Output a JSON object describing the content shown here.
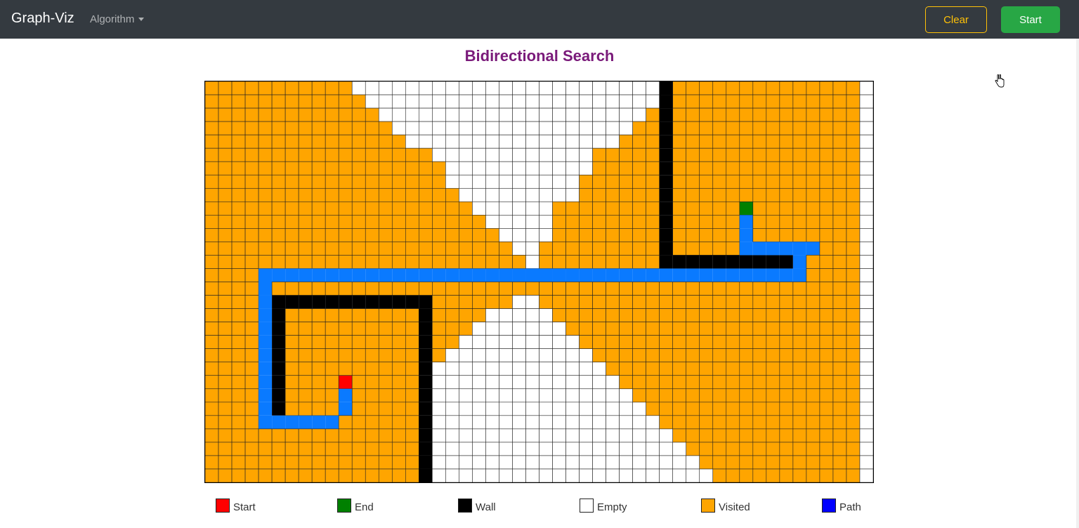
{
  "navbar": {
    "brand": "Graph-Viz",
    "algorithm_menu": "Algorithm",
    "clear_label": "Clear",
    "start_label": "Start"
  },
  "page": {
    "title": "Bidirectional Search"
  },
  "grid": {
    "rows": 30,
    "cols": 50,
    "colors": {
      "S": "#ff0000",
      "E": "#008000",
      "W": "#000000",
      ".": "#ffffff",
      "v": "#ffa500",
      "p": "#0a7aff"
    },
    "cells": [
      "vvvvvvvvvvv.......................Wvvvvvvvvvvvvvv",
      "vvvvvvvvvvvv......................Wvvvvvvvvvvvvvv",
      "vvvvvvvvvvvvv....................vWvvvvvvvvvvvvvv",
      "vvvvvvvvvvvvvv..................vvWvvvvvvvvvvvvvv",
      "vvvvvvvvvvvvvvv................vvvWvvvvvvvvvvvvvv",
      "vvvvvvvvvvvvvvvvv............vvvvvWvvvvvvvvvvvvvv",
      "vvvvvvvvvvvvvvvvvv...........vvvvvWvvvvvvvvvvvvvv",
      "vvvvvvvvvvvvvvvvvv..........vvvvvvWvvvvvvvvvvvvvv",
      "vvvvvvvvvvvvvvvvvvv.........vvvvvvWvvvvvvvvvvvvvv",
      "vvvvvvvvvvvvvvvvvvvv......vvvvvvvvWvvvvvEvvvvvvvv",
      "vvvvvvvvvvvvvvvvvvvvv.....vvvvvvvvWvvvvvpvvvvvvvv",
      "vvvvvvvvvvvvvvvvvvvvvv....vvvvvvvvWvvvvvpvvvvvvvv",
      "vvvvvvvvvvvvvvvvvvvvvvv..vvvvvvvvvWvvvvvppppppvvv",
      "vvvvvvvvvvvvvvvvvvvvvvvv.vvvvvvvvvWWWWWWWWWWpvvvv",
      "vvvvpppppppppppppppppppppppppppppppppppppppppvvvv",
      "vvvvpvvvvvvvvvvvvvvvvvvvvvvvvvvvvvvvvvvvvvvvvvvvv",
      "vvvvpWWWWWWWWWWWWvvvvvv..vvvvvvvvvvvvvvvvvvvvvvvv",
      "vvvvpWvvvvvvvvvvWvvvv.....vvvvvvvvvvvvvvvvvvvvvvv",
      "vvvvpWvvvvvvvvvvWvvv.......vvvvvvvvvvvvvvvvvvvvvv",
      "vvvvpWvvvvvvvvvvWvv.........vvvvvvvvvvvvvvvvvvvvv",
      "vvvvpWvvvvvvvvvvWv...........vvvvvvvvvvvvvvvvvvvv",
      "vvvvpWvvvvvvvvvvW.............vvvvvvvvvvvvvvvvvvv",
      "vvvvpWvvvvSvvvvvW..............vvvvvvvvvvvvvvvvvv",
      "vvvvpWvvvvpvvvvvW...............vvvvvvvvvvvvvvvvv",
      "vvvvpWvvvvpvvvvvW................vvvvvvvvvvvvvvvv",
      "vvvvppppppvvvvvvW.................vvvvvvvvvvvvvvv",
      "vvvvvvvvvvvvvvvvW..................vvvvvvvvvvvvvv",
      "vvvvvvvvvvvvvvvvW...................vvvvvvvvvvvvv",
      "vvvvvvvvvvvvvvvvW....................vvvvvvvvvvvv",
      "vvvvvvvvvvvvvvvvW.....................vvvvvvvvvvv"
    ]
  },
  "legend": [
    {
      "label": "Start",
      "color": "#ff0000"
    },
    {
      "label": "End",
      "color": "#008000"
    },
    {
      "label": "Wall",
      "color": "#000000"
    },
    {
      "label": "Empty",
      "color": "#ffffff"
    },
    {
      "label": "Visited",
      "color": "#ffa500"
    },
    {
      "label": "Path",
      "color": "#0000ff"
    }
  ]
}
